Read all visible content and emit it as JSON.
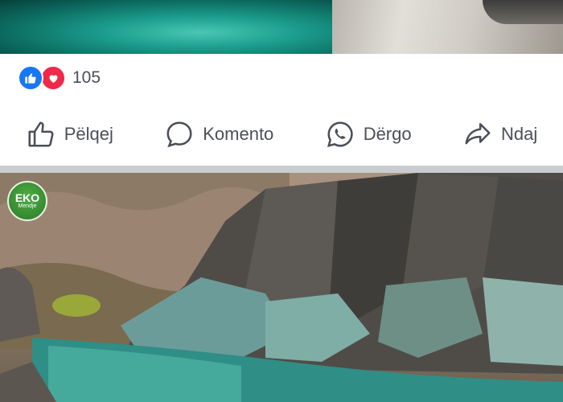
{
  "reactions": {
    "count": "105",
    "icons": [
      "like-icon",
      "love-icon"
    ]
  },
  "actions": [
    {
      "label": "Pëlqej",
      "icon": "thumbs-up-icon"
    },
    {
      "label": "Komento",
      "icon": "comment-icon"
    },
    {
      "label": "Dërgo",
      "icon": "whatsapp-icon"
    },
    {
      "label": "Ndaj",
      "icon": "share-icon"
    }
  ],
  "badge": {
    "line1": "EKO",
    "line2": "Mendje"
  },
  "colors": {
    "like": "#1877f2",
    "love": "#f02849",
    "text": "#4b4f56",
    "divider": "#c9ccd1"
  }
}
